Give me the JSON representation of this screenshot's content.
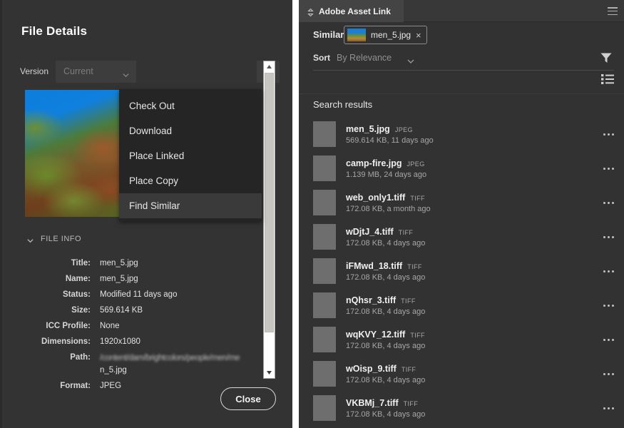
{
  "dialog": {
    "title": "File Details",
    "version_label": "Version",
    "version_value": "Current",
    "more_button_label": "...",
    "close_label": "Close"
  },
  "context_menu": {
    "items": [
      {
        "label": "Check Out",
        "selected": false
      },
      {
        "label": "Download",
        "selected": false
      },
      {
        "label": "Place Linked",
        "selected": false
      },
      {
        "label": "Place Copy",
        "selected": false
      },
      {
        "label": "Find Similar",
        "selected": true
      }
    ]
  },
  "file_info": {
    "section_title": "FILE INFO",
    "rows": [
      {
        "key": "Title:",
        "value": "men_5.jpg"
      },
      {
        "key": "Name:",
        "value": "men_5.jpg"
      },
      {
        "key": "Status:",
        "value": "Modified 11 days ago"
      },
      {
        "key": "Size:",
        "value": "569.614 KB"
      },
      {
        "key": "ICC Profile:",
        "value": "None"
      },
      {
        "key": "Dimensions:",
        "value": "1920x1080"
      },
      {
        "key": "Format:",
        "value": "JPEG"
      }
    ],
    "path_key": "Path:",
    "path_line1": "/content/dam/brightcolors/people/men/me",
    "path_line2_redacted": "n_5",
    "path_line2_suffix": ".jpg"
  },
  "panel": {
    "tab_label": "Adobe Asset Link",
    "similar_label": "Similar",
    "similar_chip_name": "men_5.jpg",
    "similar_chip_close": "×",
    "sort_label": "Sort",
    "sort_value": "By Relevance",
    "results_title": "Search results"
  },
  "results": [
    {
      "name": "men_5.jpg",
      "type": "JPEG",
      "meta": "569.614 KB, 11 days ago",
      "thumb": "tb-sunset"
    },
    {
      "name": "camp-fire.jpg",
      "type": "JPEG",
      "meta": "1.139 MB, 24 days ago",
      "thumb": "tb-camp"
    },
    {
      "name": "web_only1.tiff",
      "type": "TIFF",
      "meta": "172.08 KB, a month ago",
      "thumb": "tb-field"
    },
    {
      "name": "wDjtJ_4.tiff",
      "type": "TIFF",
      "meta": "172.08 KB, 4 days ago",
      "thumb": "tb-field"
    },
    {
      "name": "iFMwd_18.tiff",
      "type": "TIFF",
      "meta": "172.08 KB, 4 days ago",
      "thumb": "tb-field"
    },
    {
      "name": "nQhsr_3.tiff",
      "type": "TIFF",
      "meta": "172.08 KB, 4 days ago",
      "thumb": "tb-field"
    },
    {
      "name": "wqKVY_12.tiff",
      "type": "TIFF",
      "meta": "172.08 KB, 4 days ago",
      "thumb": "tb-field"
    },
    {
      "name": "wOisp_9.tiff",
      "type": "TIFF",
      "meta": "172.08 KB, 4 days ago",
      "thumb": "tb-field"
    },
    {
      "name": "VKBMj_7.tiff",
      "type": "TIFF",
      "meta": "172.08 KB, 4 days ago",
      "thumb": "tb-field"
    }
  ],
  "colors": {
    "dialog_bg": "#333333",
    "panel_bg": "#323232",
    "menu_bg": "#252525",
    "menu_selected_bg": "#3a3a3a",
    "tab_active_bg": "#444444",
    "scrollbar_track": "#ffffff",
    "scrollbar_thumb": "#c8c6c0",
    "text_primary": "#f0f0f0",
    "text_muted": "#a6a6a6"
  }
}
